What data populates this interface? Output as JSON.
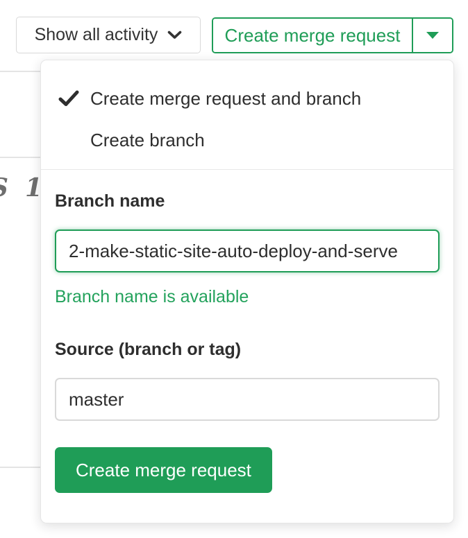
{
  "toolbar": {
    "activity_button": {
      "label": "Show all activity"
    },
    "split_button": {
      "label": "Create merge request"
    }
  },
  "dropdown": {
    "options": [
      {
        "label": "Create merge request and branch",
        "checked": true
      },
      {
        "label": "Create branch",
        "checked": false
      }
    ],
    "branch_name": {
      "label": "Branch name",
      "value": "2-make-static-site-auto-deploy-and-serve",
      "help": "Branch name is available"
    },
    "source": {
      "label": "Source (branch or tag)",
      "value": "master"
    },
    "submit_label": "Create merge request"
  },
  "background": {
    "partial_glyph_left": "S",
    "partial_glyph_right": "1"
  },
  "colors": {
    "green": "#1f9d57",
    "help_green": "#23a25c",
    "text_dark": "#303030",
    "border_gray": "#d9d9d9",
    "line_gray": "#e4e4e4"
  }
}
